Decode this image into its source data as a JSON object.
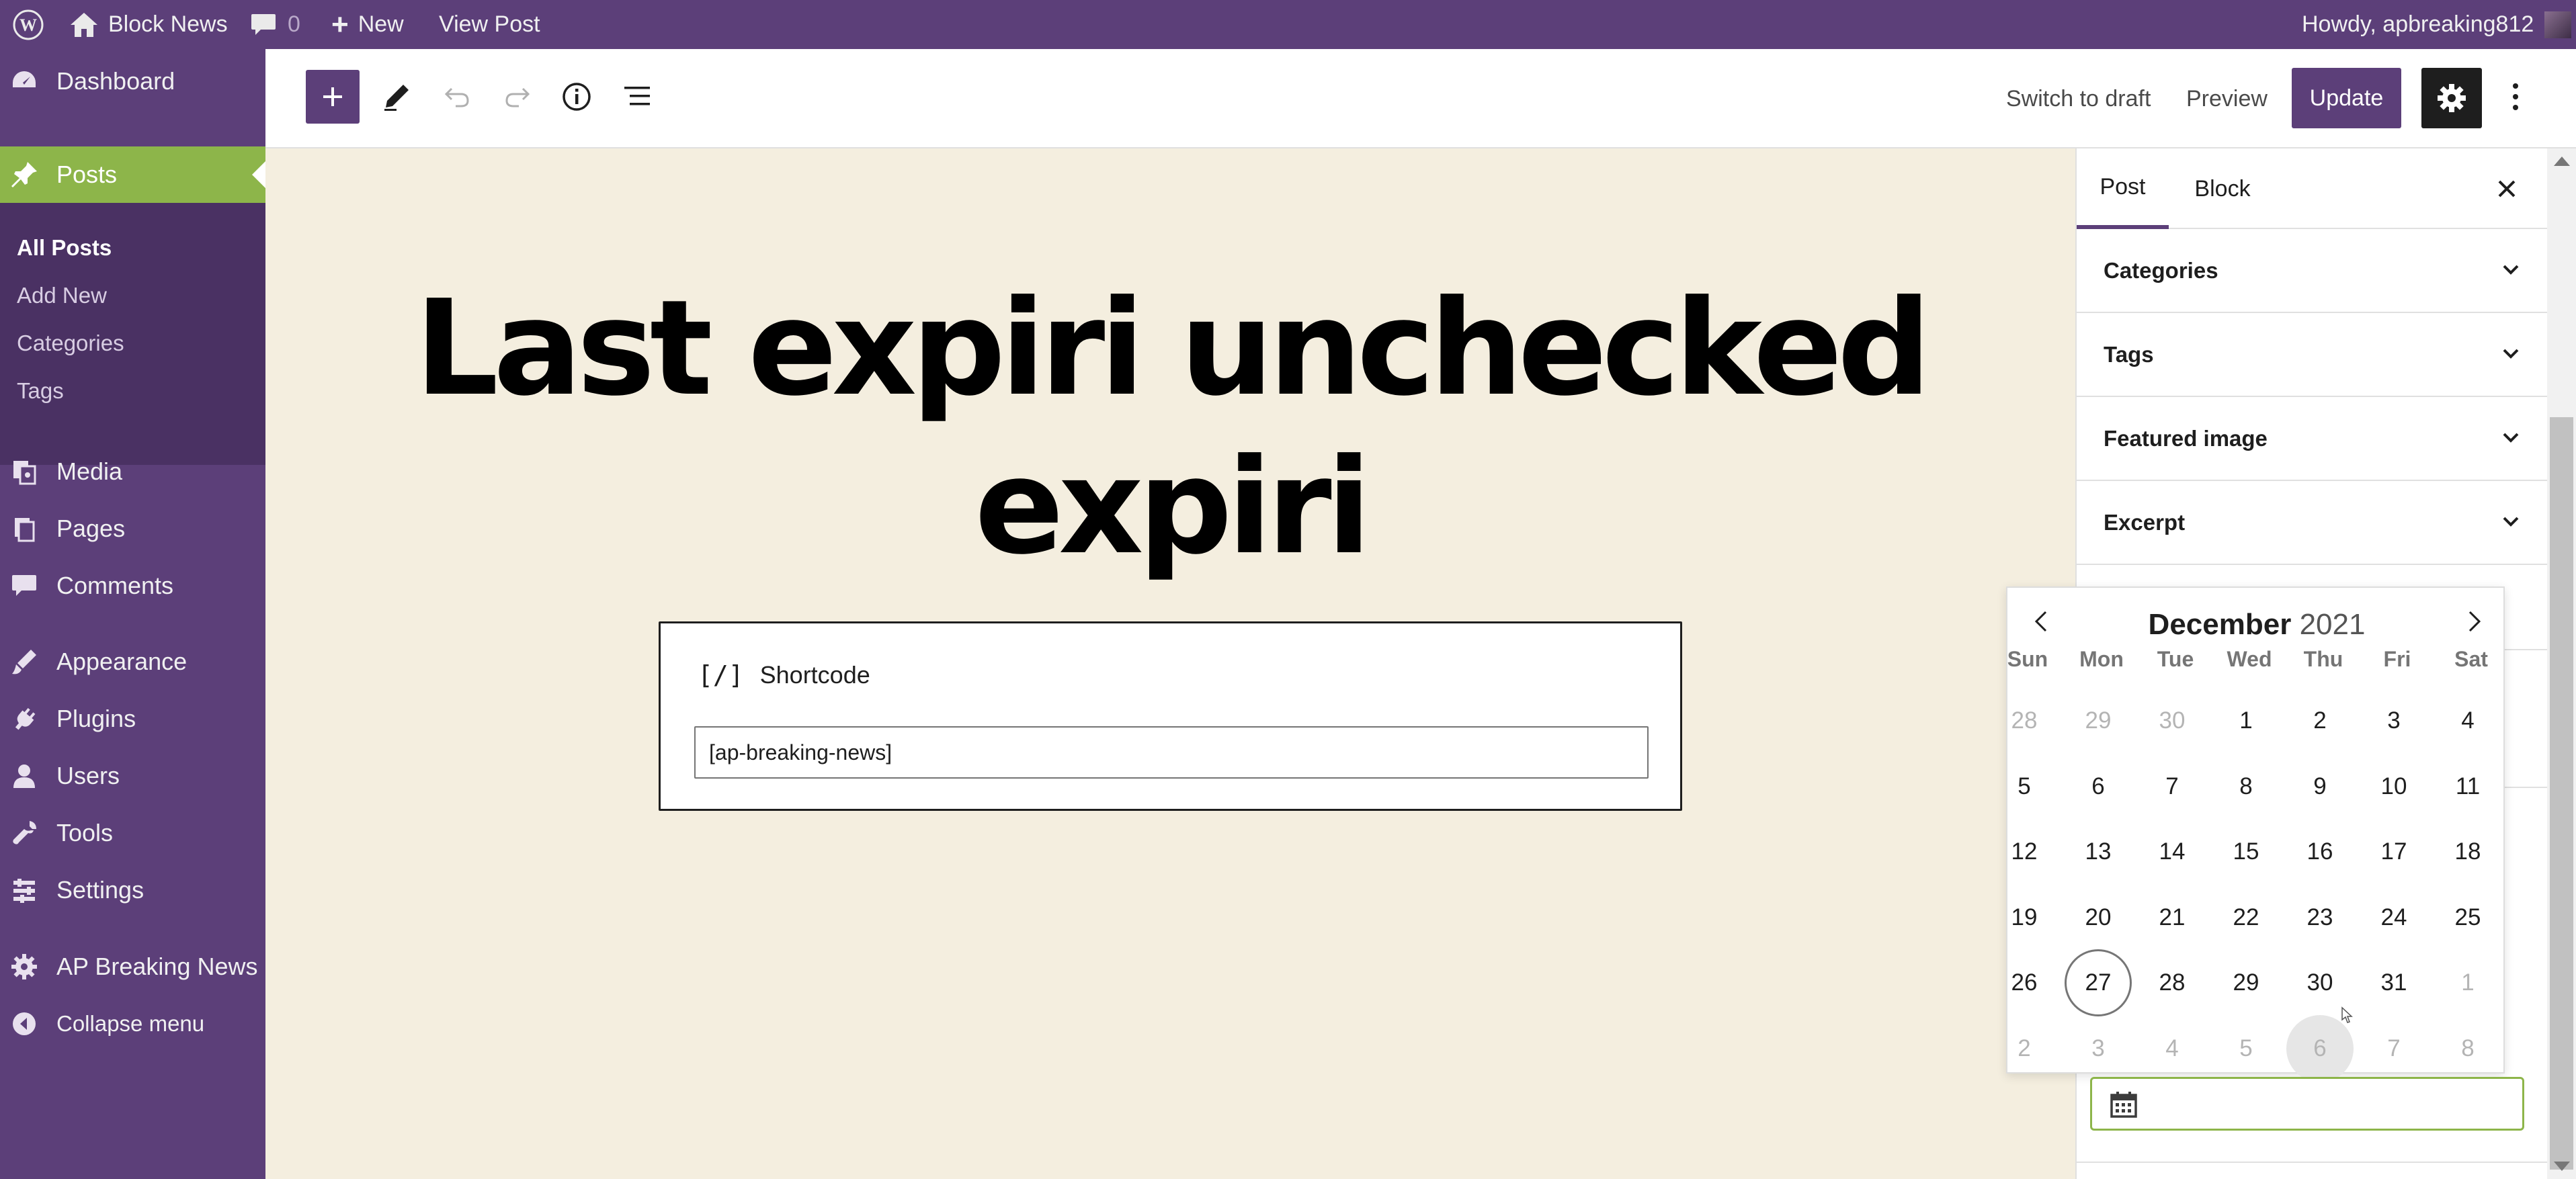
{
  "admin_bar": {
    "site_name": "Block News",
    "comments_count": "0",
    "new_label": "New",
    "view_post_label": "View Post",
    "greeting": "Howdy, apbreaking812"
  },
  "admin_menu": {
    "items": [
      {
        "label": "Dashboard",
        "icon": "dashboard-icon"
      },
      {
        "label": "Posts",
        "icon": "pin-icon"
      },
      {
        "label": "Media",
        "icon": "media-icon"
      },
      {
        "label": "Pages",
        "icon": "pages-icon"
      },
      {
        "label": "Comments",
        "icon": "comment-icon"
      },
      {
        "label": "Appearance",
        "icon": "brush-icon"
      },
      {
        "label": "Plugins",
        "icon": "plug-icon"
      },
      {
        "label": "Users",
        "icon": "user-icon"
      },
      {
        "label": "Tools",
        "icon": "wrench-icon"
      },
      {
        "label": "Settings",
        "icon": "settings-icon"
      },
      {
        "label": "AP Breaking News",
        "icon": "gear-icon"
      },
      {
        "label": "Collapse menu",
        "icon": "collapse-icon"
      }
    ],
    "posts_submenu": [
      "All Posts",
      "Add New",
      "Categories",
      "Tags"
    ],
    "accent_color": "#8db54a",
    "background_color": "#5c3f79"
  },
  "toolbar": {
    "switch_to_draft": "Switch to draft",
    "preview": "Preview",
    "update": "Update"
  },
  "editor": {
    "title_line1": "Last expiri unchecked",
    "title_line2": "expiri",
    "block_name": "Shortcode",
    "block_icon": "[/]",
    "shortcode_value": "[ap-breaking-news]"
  },
  "sidebar": {
    "tabs": [
      "Post",
      "Block"
    ],
    "panels": [
      "Categories",
      "Tags",
      "Featured image",
      "Excerpt"
    ]
  },
  "datepicker": {
    "month": "December",
    "year": "2021",
    "weekdays": [
      "Sun",
      "Mon",
      "Tue",
      "Wed",
      "Thu",
      "Fri",
      "Sat"
    ],
    "weeks": [
      [
        "28",
        "29",
        "30",
        "1",
        "2",
        "3",
        "4"
      ],
      [
        "5",
        "6",
        "7",
        "8",
        "9",
        "10",
        "11"
      ],
      [
        "12",
        "13",
        "14",
        "15",
        "16",
        "17",
        "18"
      ],
      [
        "19",
        "20",
        "21",
        "22",
        "23",
        "24",
        "25"
      ],
      [
        "26",
        "27",
        "28",
        "29",
        "30",
        "31",
        "1"
      ],
      [
        "2",
        "3",
        "4",
        "5",
        "6",
        "7",
        "8"
      ]
    ],
    "today": "27",
    "hovered": "6"
  }
}
